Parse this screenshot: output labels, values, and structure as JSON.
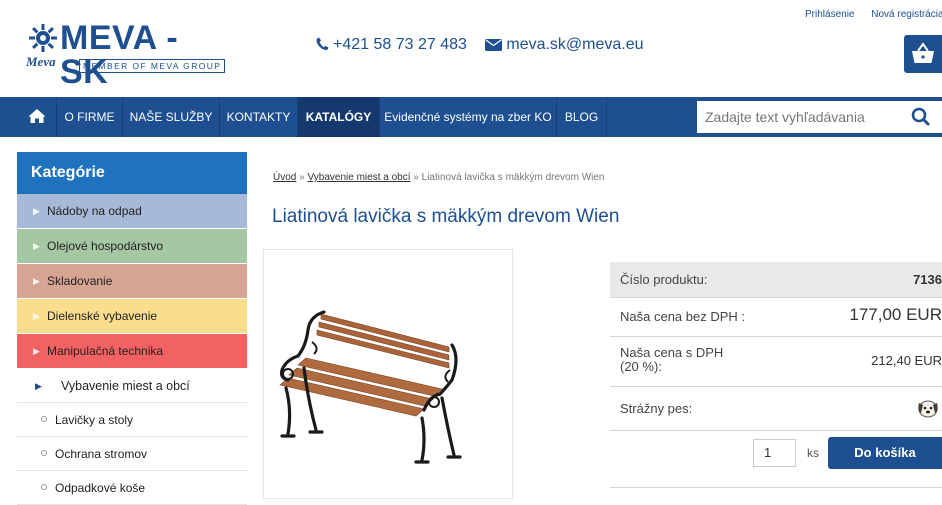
{
  "top_links": {
    "login": "Prihlásenie",
    "register": "Nová registrácia"
  },
  "logo": {
    "main": "MEVA - SK",
    "script": "Meva",
    "tagline": "MEMBER OF MEVA GROUP"
  },
  "contact": {
    "phone": "+421 58 73 27 483",
    "email": "meva.sk@meva.eu"
  },
  "nav": {
    "items": [
      "O FIRME",
      "NAŠE SLUŽBY",
      "KONTAKTY",
      "KATALÓGY",
      "Evidenčné systémy na zber KO",
      "BLOG"
    ],
    "active": "KATALÓGY",
    "search_placeholder": "Zadajte text vyhľadávania"
  },
  "sidebar": {
    "title": "Kategórie",
    "categories": [
      {
        "label": "Nádoby na odpad",
        "color": "#a7b9d7"
      },
      {
        "label": "Olejové hospodárstvo",
        "color": "#a6c7a4"
      },
      {
        "label": "Skladovanie",
        "color": "#d6a493"
      },
      {
        "label": "Dielenské vybavenie",
        "color": "#fbdd8e"
      },
      {
        "label": "Manipulačná technika",
        "color": "#f26262"
      }
    ],
    "current": "Vybavenie miest a obcí",
    "subitems": [
      "Lavičky a stoly",
      "Ochrana stromov",
      "Odpadkové koše"
    ]
  },
  "breadcrumb": {
    "home": "Úvod",
    "sep": "»",
    "level1": "Vybavenie miest a obcí",
    "current": "Liatinová lavička s mäkkým drevom Wien"
  },
  "product": {
    "title": "Liatinová lavička s mäkkým drevom Wien",
    "rows": {
      "code_label": "Číslo produktu:",
      "code_value": "7136",
      "price_net_label": "Naša cena bez DPH :",
      "price_net_value": "177,00 EUR",
      "price_gross_label_1": "Naša cena s DPH",
      "price_gross_label_2": "(20 %):",
      "price_gross_value": "212,40 EUR",
      "watchdog_label": "Strážny pes:"
    },
    "quantity": "1",
    "unit": "ks",
    "buy_label": "Do košíka"
  },
  "colors": {
    "brand": "#1d4f91",
    "sidebar_title": "#1f73be"
  }
}
